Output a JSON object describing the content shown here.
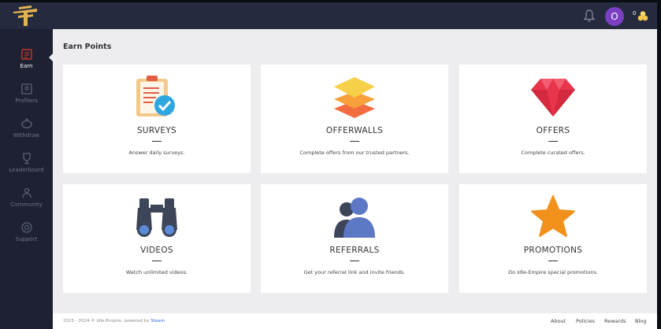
{
  "main": {
    "title": "Earn Points",
    "cards": [
      {
        "title": "SURVEYS",
        "description": "Answer daily surveys."
      },
      {
        "title": "OFFERWALLS",
        "description": "Complete offers from our trusted partners."
      },
      {
        "title": "OFFERS",
        "description": "Complete curated offers."
      },
      {
        "title": "VIDEOS",
        "description": "Watch unlimited videos."
      },
      {
        "title": "REFERRALS",
        "description": "Get your referral link and invite friends."
      },
      {
        "title": "PROMOTIONS",
        "description": "Do Idle-Empire special promotions."
      }
    ]
  },
  "sidebar": {
    "items": [
      {
        "label": "Earn",
        "icon": "earn-icon"
      },
      {
        "label": "Profilers",
        "icon": "profilers-icon"
      },
      {
        "label": "Withdraw",
        "icon": "piggy-bank-icon"
      },
      {
        "label": "Leaderboard",
        "icon": "trophy-icon"
      },
      {
        "label": "Community",
        "icon": "community-icon"
      },
      {
        "label": "Support",
        "icon": "support-icon"
      }
    ]
  },
  "header": {
    "avatar_letter": "O",
    "points": "0"
  },
  "footer": {
    "copyright": "2015 - 2024 © Idle-Empire, powered by",
    "powered_by": "Steam",
    "links": [
      "About",
      "Policies",
      "Rewards",
      "Blog"
    ]
  },
  "colors": {
    "topbar": "#252a3e",
    "sidebar": "#1d2132",
    "accent_avatar": "#7b3fc4",
    "logo_gold": "#e2b44e",
    "content_bg": "#ededf0"
  }
}
